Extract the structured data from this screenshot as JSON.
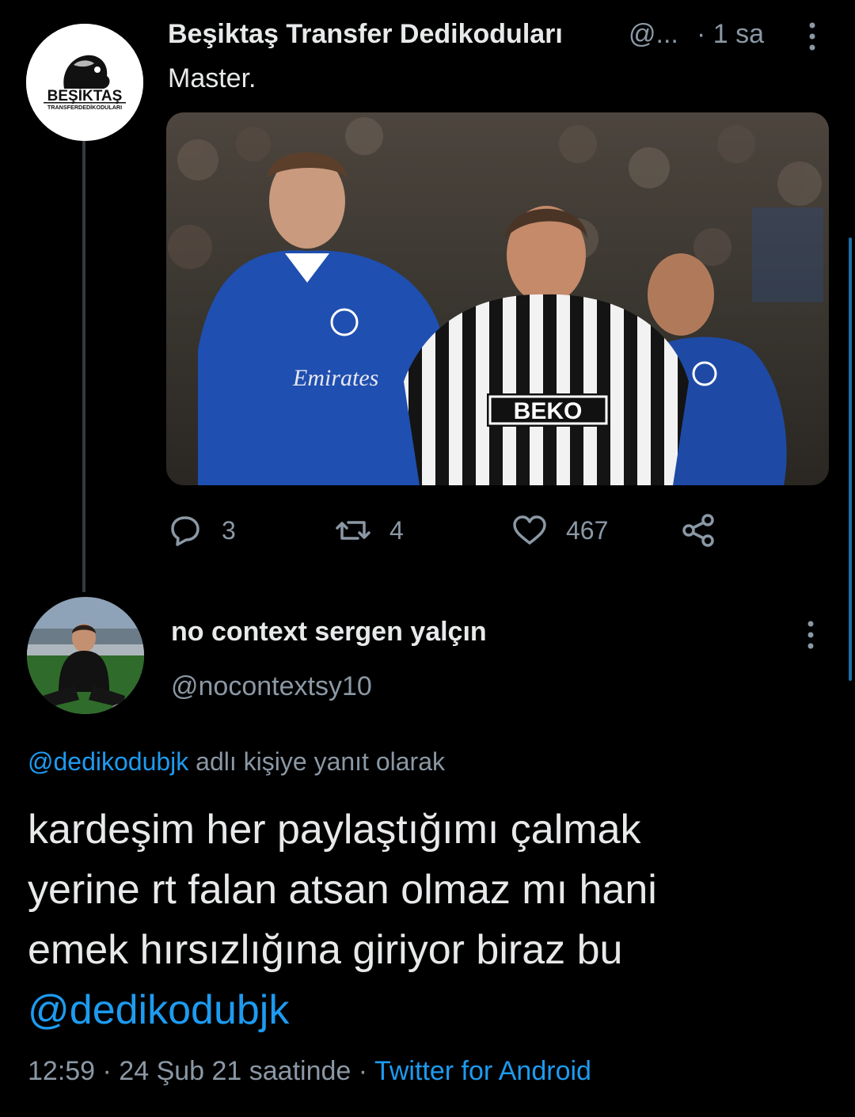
{
  "tweet1": {
    "display_name": "Beşiktaş Transfer Dedikoduları",
    "handle_truncated": "@...",
    "time": "· 1 sa",
    "text": "Master.",
    "avatar_logo_text": "BEŞİKTAŞ",
    "avatar_logo_subtext": "TRANSFERDEDİKODULARI",
    "media_shirt_sponsor": "BEKO",
    "media_chelsea_sponsor": "Emirates",
    "actions": {
      "reply_count": "3",
      "retweet_count": "4",
      "like_count": "467"
    }
  },
  "tweet2": {
    "display_name": "no context sergen yalçın",
    "handle": "@nocontextsy10",
    "replying_to_handle": "@dedikodubjk",
    "replying_to_suffix": "adlı kişiye yanıt olarak",
    "text_lines": [
      "kardeşim her paylaştığımı çalmak",
      "yerine rt falan atsan olmaz mı hani",
      "emek hırsızlığına giriyor biraz bu"
    ],
    "text_mention": "@dedikodubjk",
    "timestamp": "12:59 · 24 Şub 21 saatinde ·",
    "source": "Twitter for Android"
  },
  "icons": [
    "more-vertical-icon",
    "reply-icon",
    "retweet-icon",
    "like-icon",
    "share-icon"
  ],
  "colors": {
    "background": "#000000",
    "text": "#e7e9ea",
    "secondary": "#8b98a5",
    "link": "#1d9bf0"
  }
}
